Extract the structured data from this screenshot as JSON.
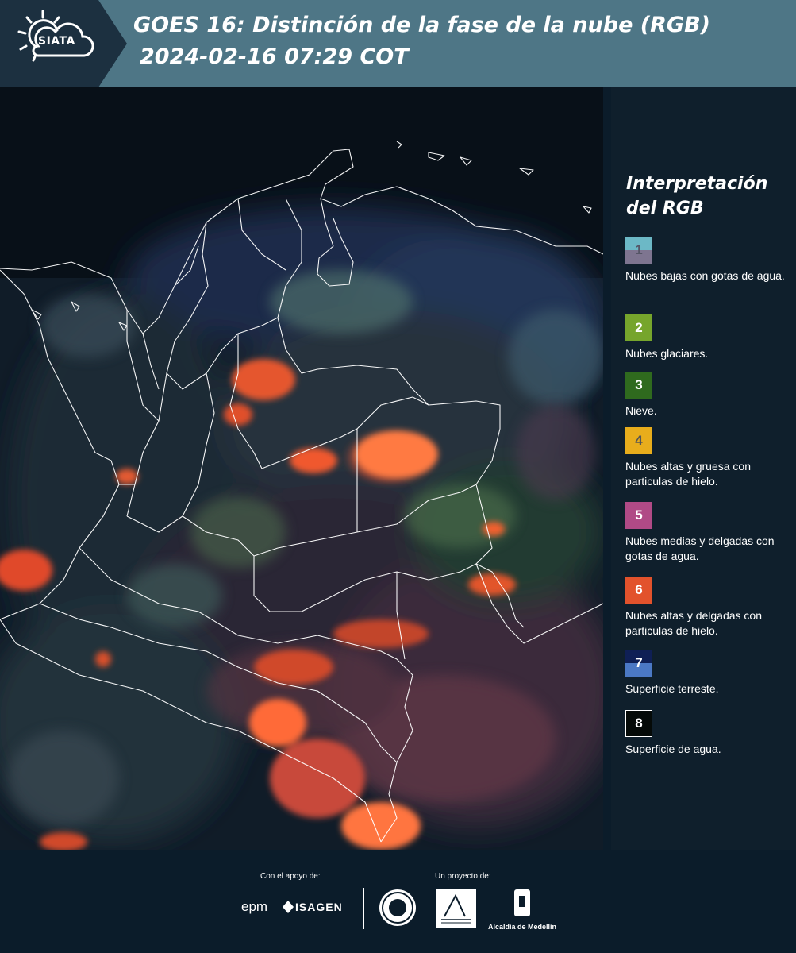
{
  "header": {
    "logo_text": "SIATA",
    "title": "GOES 16: Distinción de la fase de la nube (RGB)",
    "subtitle": "2024-02-16 07:29 COT"
  },
  "legend": {
    "title_line1": "Interpretación",
    "title_line2": "del RGB",
    "items": [
      {
        "number": "1",
        "label": "Nubes bajas con gotas de agua.",
        "color_top": "#6cb8c6",
        "color_bottom": "#7e7590",
        "number_color": "#555566"
      },
      {
        "number": "2",
        "label": "Nubes glaciares.",
        "color_top": "#76a52c",
        "color_bottom": "#76a52c",
        "number_color": "#ffffff"
      },
      {
        "number": "3",
        "label": "Nieve.",
        "color_top": "#2f6a1e",
        "color_bottom": "#2f6a1e",
        "number_color": "#ffffff"
      },
      {
        "number": "4",
        "label": "Nubes altas y gruesa con particulas de hielo.",
        "color_top": "#e8ad1c",
        "color_bottom": "#e8ad1c",
        "number_color": "#555555"
      },
      {
        "number": "5",
        "label": "Nubes medias y delgadas con gotas de agua.",
        "color_top": "#b04a86",
        "color_bottom": "#b04a86",
        "number_color": "#ffffff"
      },
      {
        "number": "6",
        "label": "Nubes altas y delgadas con particulas de hielo.",
        "color_top": "#e2522c",
        "color_bottom": "#e2522c",
        "number_color": "#ffffff"
      },
      {
        "number": "7",
        "label": "Superficie terreste.",
        "color_top": "#0f1f55",
        "color_bottom": "#4b78c4",
        "number_color": "#ffffff"
      },
      {
        "number": "8",
        "label": "Superficie de agua.",
        "color_top": "#050a08",
        "color_bottom": "#050a08",
        "number_color": "#ffffff"
      }
    ]
  },
  "footer": {
    "support_label": "Con el apoyo de:",
    "project_label": "Un proyecto de:",
    "epm": "epm",
    "isagen": "ISAGEN",
    "medellin": "Alcaldía de Medellín"
  }
}
